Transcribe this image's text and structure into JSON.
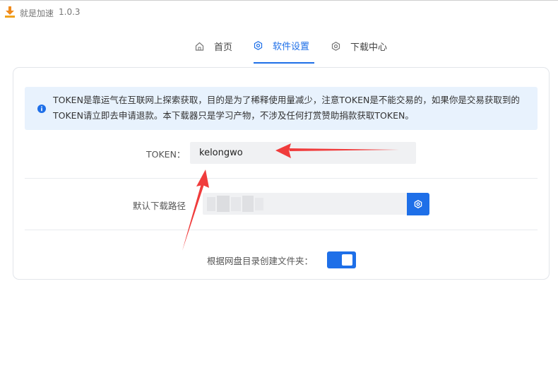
{
  "app": {
    "title": "就是加速",
    "version": "1.0.3"
  },
  "tabs": [
    {
      "label": "首页",
      "icon": "home-icon",
      "active": false
    },
    {
      "label": "软件设置",
      "icon": "gear-icon",
      "active": true
    },
    {
      "label": "下载中心",
      "icon": "gear-icon",
      "active": false
    }
  ],
  "notice": {
    "text": "TOKEN是靠运气在互联网上探索获取，目的是为了稀释使用量减少，注意TOKEN是不能交易的，如果你是交易获取到的TOKEN请立即去申请退款。本下载器只是学习产物，不涉及任何打赏赞助捐款获取TOKEN。",
    "icon": "info-icon"
  },
  "settings": {
    "token_label": "TOKEN：",
    "token_value": "kelongwo",
    "path_label": "默认下载路径",
    "path_value": "",
    "path_button_icon": "gear-icon",
    "folder_label": "根据网盘目录创建文件夹：",
    "folder_toggle_on": true
  },
  "colors": {
    "accent": "#1e6fe8",
    "notice_bg": "#e8f2fd",
    "input_bg": "#f0f1f3",
    "annotation_arrow": "#f03c3c"
  }
}
